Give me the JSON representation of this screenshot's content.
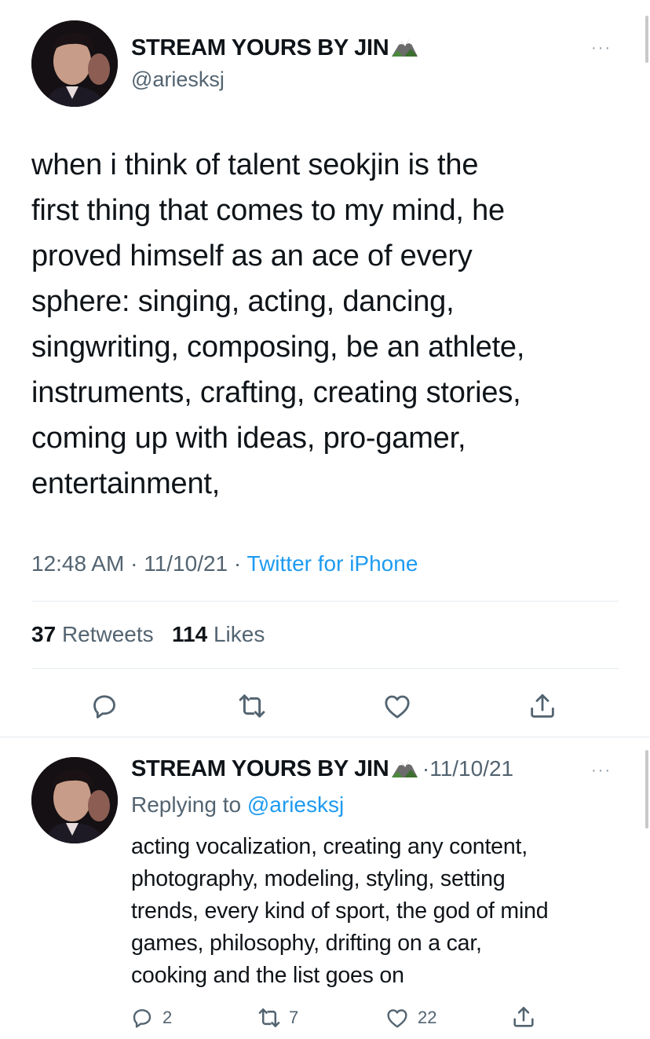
{
  "tweet": {
    "author_name": "STREAM YOURS BY JIN",
    "author_emoji": "🏔",
    "handle": "@ariesksj",
    "text": "when i think of talent seokjin is the\nfirst thing that comes to my mind, he\nproved himself as an ace of every\nsphere: singing, acting, dancing,\nsingwriting, composing, be an athlete,\ninstruments, crafting, creating stories,\ncoming up with ideas, pro-gamer,\nentertainment,",
    "time": "12:48 AM",
    "date": "11/10/21",
    "source": "Twitter for iPhone",
    "retweets_count": "37",
    "retweets_label": "Retweets",
    "likes_count": "114",
    "likes_label": "Likes"
  },
  "reply": {
    "author_name": "STREAM YOURS BY JIN",
    "author_emoji": "🏔",
    "date": "11/10/21",
    "replying_prefix": "Replying to",
    "replying_handle": "@ariesksj",
    "text": "acting vocalization, creating any content,\nphotography, modeling, styling, setting\ntrends, every kind of sport, the god of mind\ngames, philosophy, drifting on a car,\ncooking and the list goes on",
    "reply_count": "2",
    "retweet_count": "7",
    "like_count": "22"
  },
  "ui": {
    "separator": "·",
    "more": "···"
  },
  "icons": [
    "more-icon",
    "reply-icon",
    "retweet-icon",
    "like-icon",
    "share-icon",
    "mountain-icon"
  ],
  "colors": {
    "link": "#1d9bf0",
    "secondary": "#536471",
    "divider": "#e6ecf0"
  }
}
